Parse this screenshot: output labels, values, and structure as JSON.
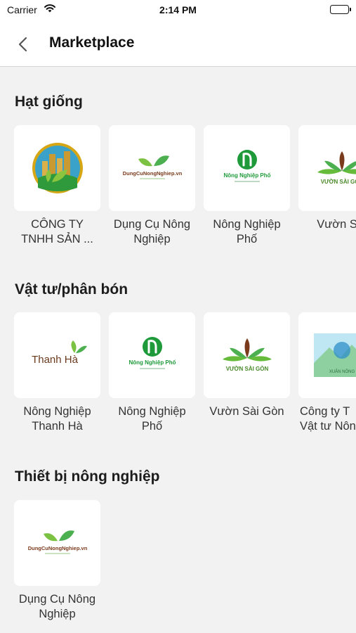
{
  "status_bar": {
    "carrier": "Carrier",
    "time": "2:14 PM"
  },
  "nav": {
    "title": "Marketplace"
  },
  "sections": [
    {
      "title": "Hạt giống",
      "items": [
        {
          "name": "CÔNG TY TNHH SẢN ...",
          "logo": "company-logo-icon"
        },
        {
          "name": "Dụng Cụ Nông Nghiệp",
          "logo": "dungcunongnghiep-logo",
          "logo_text": "DungCuNongNghiep.vn"
        },
        {
          "name": "Nông Nghiệp Phố",
          "logo": "nongnghiepphoe-logo",
          "logo_text": "Nông Nghiệp Phố"
        },
        {
          "name": "Vườn Sài",
          "logo": "vuonsaigon-logo",
          "logo_text": "VƯỜN SÀI GÒN"
        }
      ]
    },
    {
      "title": "Vật tư/phân bón",
      "items": [
        {
          "name": "Nông Nghiệp Thanh Hà",
          "logo": "thanhha-logo",
          "logo_text": "Thanh Hà"
        },
        {
          "name": "Nông Nghiệp Phố",
          "logo": "nongnghiepphoe-logo",
          "logo_text": "Nông Nghiệp Phố"
        },
        {
          "name": "Vườn Sài Gòn",
          "logo": "vuonsaigon-logo",
          "logo_text": "VƯỜN SÀI GÒN"
        },
        {
          "name": "Công ty T Vật tư Nôn",
          "logo": "landscape-logo",
          "logo_text": "XUÂN NÔNG"
        }
      ]
    },
    {
      "title": "Thiết bị nông nghiệp",
      "items": [
        {
          "name": "Dụng Cụ Nông Nghiệp",
          "logo": "dungcunongnghiep-logo",
          "logo_text": "DungCuNongNghiep.vn"
        }
      ]
    }
  ],
  "colors": {
    "green": "#1f9a3b",
    "gold": "#d6a615",
    "brown": "#7a3b1d",
    "background": "#f2f2f2"
  }
}
